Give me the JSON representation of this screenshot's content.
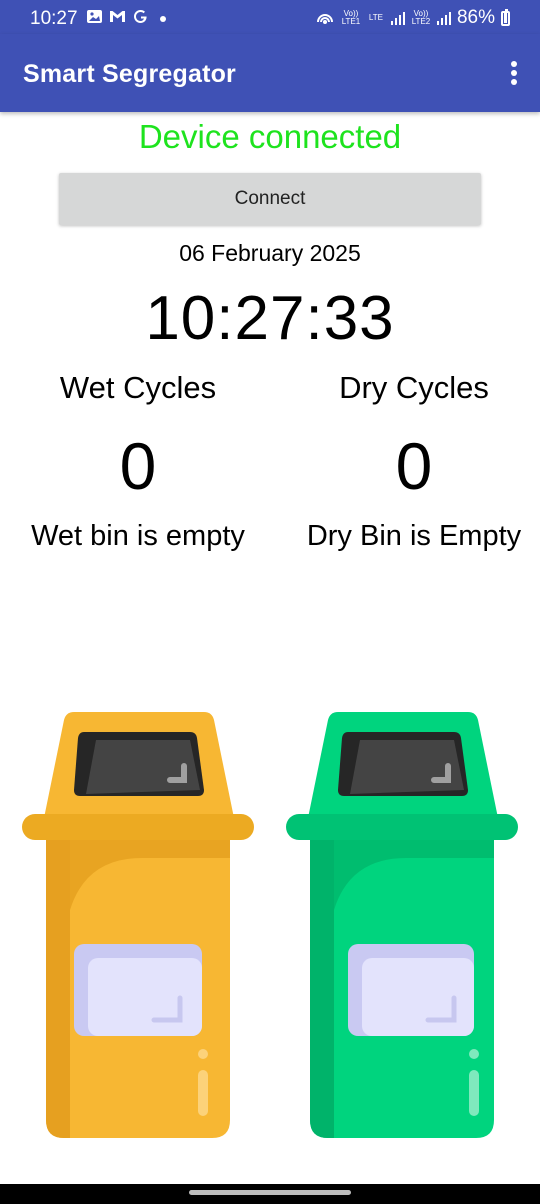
{
  "status_bar": {
    "time": "10:27",
    "battery_percent": "86%",
    "sim1_label": "Vo)) LTE1",
    "lte_label": "LTE",
    "sim2_label": "Vo)) LTE2"
  },
  "app_bar": {
    "title": "Smart Segregator"
  },
  "connection": {
    "status_text": "Device connected",
    "status_color": "#1ee31e",
    "connect_label": "Connect"
  },
  "datetime": {
    "date": "06 February 2025",
    "time": "10:27:33"
  },
  "wet": {
    "label": "Wet Cycles",
    "count": "0",
    "status": "Wet bin is empty",
    "bin_color": "#f7b733",
    "icon": "wet-bin-icon"
  },
  "dry": {
    "label": "Dry Cycles",
    "count": "0",
    "status": "Dry Bin is Empty",
    "bin_color": "#00d47e",
    "icon": "dry-bin-icon"
  },
  "colors": {
    "app_bar": "#3f51b5",
    "button": "#d6d7d7"
  }
}
